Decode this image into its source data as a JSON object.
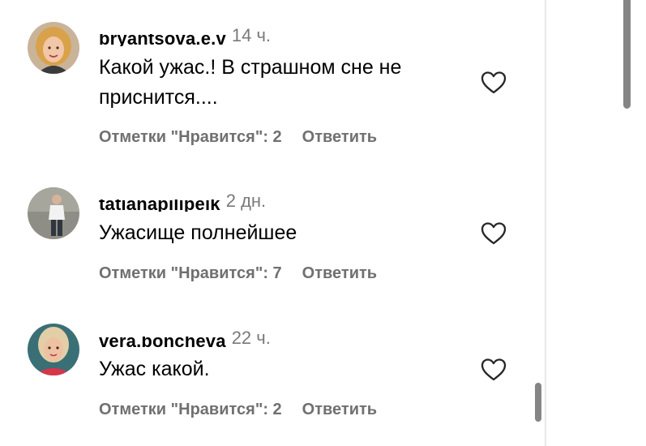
{
  "comments": [
    {
      "username": "bryantsova.e.v",
      "time": "14 ч.",
      "text": "Какой ужас.! В страшном сне не приснится....",
      "likes": "Отметки \"Нравится\": 2",
      "reply": "Ответить"
    },
    {
      "username": "tatianapilipeik",
      "time": "2 дн.",
      "text": "Ужасище полнейшее",
      "likes": "Отметки \"Нравится\": 7",
      "reply": "Ответить"
    },
    {
      "username": "vera.boncheva",
      "time": "22 ч.",
      "text": "Ужас какой.",
      "likes": "Отметки \"Нравится\": 2",
      "reply": "Ответить"
    }
  ],
  "icons": {
    "like": "heart-outline-icon"
  },
  "colors": {
    "meta_text": "#707070",
    "timestamp": "#7a7a7a",
    "scrollbar": "#858585"
  }
}
